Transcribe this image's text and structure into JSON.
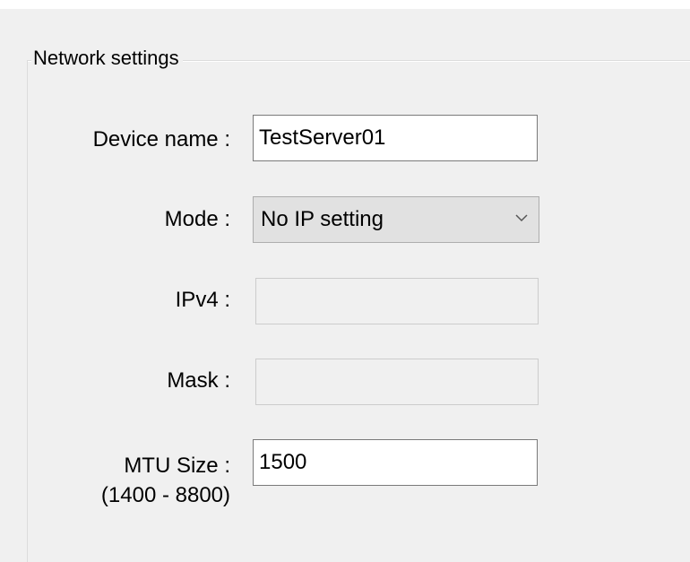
{
  "group": {
    "title": "Network settings"
  },
  "fields": {
    "device_name": {
      "label": "Device name :",
      "value": "TestServer01"
    },
    "mode": {
      "label": "Mode :",
      "selected": "No IP setting"
    },
    "ipv4": {
      "label": "IPv4 :",
      "value": ""
    },
    "mask": {
      "label": "Mask :",
      "value": ""
    },
    "mtu": {
      "label": "MTU Size :",
      "range_label": "(1400 - 8800)",
      "value": "1500"
    }
  },
  "icons": {
    "combo_arrow": "chevron-down-icon"
  },
  "colors": {
    "background": "#f0f0f0",
    "input_background": "#ffffff",
    "combo_background": "#e1e1e1",
    "disabled_border": "#cccccc"
  }
}
